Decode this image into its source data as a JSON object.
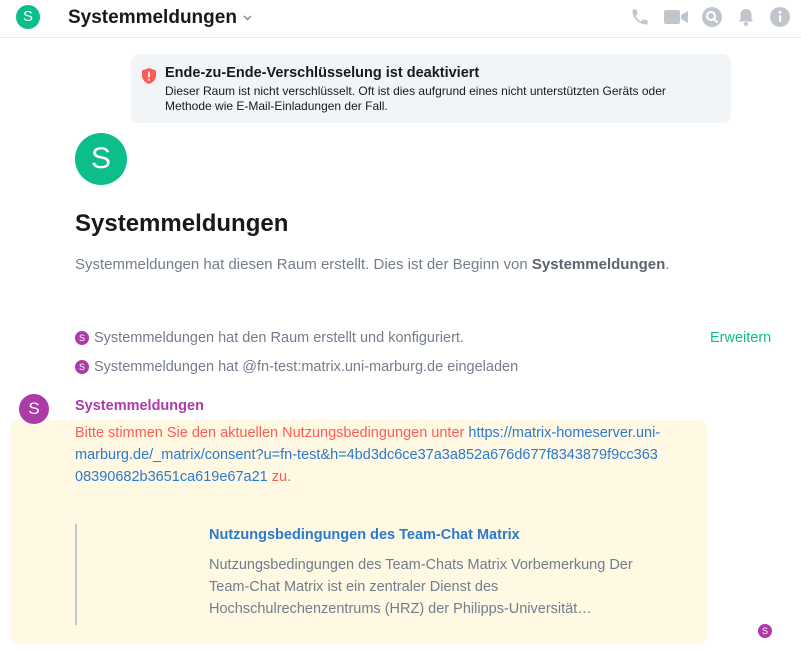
{
  "header": {
    "avatar_letter": "S",
    "title": "Systemmeldungen",
    "icons": [
      "phone-icon",
      "video-icon",
      "search-icon",
      "bell-icon",
      "info-icon"
    ]
  },
  "e2e_notice": {
    "title": "Ende-zu-Ende-Verschlüsselung ist deaktiviert",
    "description": "Dieser Raum ist nicht verschlüsselt. Oft ist dies aufgrund eines nicht unterstützten Geräts oder Methode wie E-Mail-Einladungen der Fall."
  },
  "intro": {
    "avatar_letter": "S",
    "title": "Systemmeldungen",
    "desc_prefix": "Systemmeldungen hat diesen Raum erstellt. Dies ist der Beginn von ",
    "desc_room": "Systemmeldungen",
    "desc_suffix": "."
  },
  "events": [
    {
      "avatar_letter": "S",
      "text": "Systemmeldungen hat den Raum erstellt und konfiguriert."
    },
    {
      "avatar_letter": "S",
      "text": "Systemmeldungen hat @fn-test:matrix.uni-marburg.de eingeladen"
    }
  ],
  "expand_label": "Erweitern",
  "message": {
    "avatar_letter": "S",
    "sender": "Systemmeldungen",
    "text_prefix": "Bitte stimmen Sie den aktuellen Nutzungsbedingungen unter ",
    "link": "https://matrix-homeserver.uni-marburg.de/_matrix/consent?u=fn-test&h=4bd3dc6ce37a3a852a676d677f8343879f9cc36308390682b3651ca619e67a21",
    "text_suffix": " zu.",
    "preview_title": "Nutzungsbedingungen des Team-Chat Matrix",
    "preview_desc": "Nutzungsbedingungen des Team-Chats Matrix Vorbemerkung Der Team-Chat Matrix ist ein zentraler Dienst des Hochschulrechenzentrums (HRZ) der Philipps-Universität…",
    "receipt_letter": "S"
  },
  "colors": {
    "accent": "#0dbd8b",
    "user": "#ac3ba8",
    "highlight": "#fff8e3",
    "link": "#2a7bce",
    "mention_text": "#ff5b55"
  }
}
